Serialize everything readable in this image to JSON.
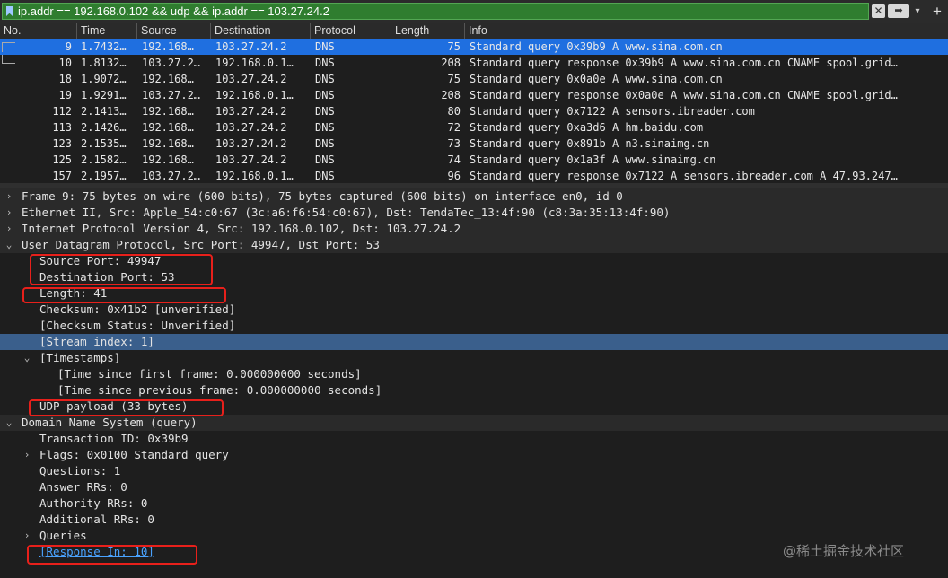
{
  "filter": {
    "value": "ip.addr == 192.168.0.102 && udp && ip.addr == 103.27.24.2",
    "clear_glyph": "✕",
    "apply_glyph": "➡",
    "dropdown_glyph": "▾",
    "add_glyph": "+"
  },
  "packet_list": {
    "columns": [
      "No.",
      "Time",
      "Source",
      "Destination",
      "Protocol",
      "Length",
      "Info"
    ],
    "rows": [
      {
        "no": "9",
        "time": "1.7432…",
        "src": "192.168…",
        "dst": "103.27.24.2",
        "proto": "DNS",
        "len": "75",
        "info": "Standard query 0x39b9 A www.sina.com.cn"
      },
      {
        "no": "10",
        "time": "1.8132…",
        "src": "103.27.2…",
        "dst": "192.168.0.1…",
        "proto": "DNS",
        "len": "208",
        "info": "Standard query response 0x39b9 A www.sina.com.cn CNAME spool.grid…"
      },
      {
        "no": "18",
        "time": "1.9072…",
        "src": "192.168…",
        "dst": "103.27.24.2",
        "proto": "DNS",
        "len": "75",
        "info": "Standard query 0x0a0e A www.sina.com.cn"
      },
      {
        "no": "19",
        "time": "1.9291…",
        "src": "103.27.2…",
        "dst": "192.168.0.1…",
        "proto": "DNS",
        "len": "208",
        "info": "Standard query response 0x0a0e A www.sina.com.cn CNAME spool.grid…"
      },
      {
        "no": "112",
        "time": "2.1413…",
        "src": "192.168…",
        "dst": "103.27.24.2",
        "proto": "DNS",
        "len": "80",
        "info": "Standard query 0x7122 A sensors.ibreader.com"
      },
      {
        "no": "113",
        "time": "2.1426…",
        "src": "192.168…",
        "dst": "103.27.24.2",
        "proto": "DNS",
        "len": "72",
        "info": "Standard query 0xa3d6 A hm.baidu.com"
      },
      {
        "no": "123",
        "time": "2.1535…",
        "src": "192.168…",
        "dst": "103.27.24.2",
        "proto": "DNS",
        "len": "73",
        "info": "Standard query 0x891b A n3.sinaimg.cn"
      },
      {
        "no": "125",
        "time": "2.1582…",
        "src": "192.168…",
        "dst": "103.27.24.2",
        "proto": "DNS",
        "len": "74",
        "info": "Standard query 0x1a3f A www.sinaimg.cn"
      },
      {
        "no": "157",
        "time": "2.1957…",
        "src": "103.27.2…",
        "dst": "192.168.0.1…",
        "proto": "DNS",
        "len": "96",
        "info": "Standard query response 0x7122 A sensors.ibreader.com A 47.93.247…"
      }
    ]
  },
  "details": [
    {
      "text": "Frame 9: 75 bytes on wire (600 bits), 75 bytes captured (600 bits) on interface en0, id 0",
      "arrow": "›"
    },
    {
      "text": "Ethernet II, Src: Apple_54:c0:67 (3c:a6:f6:54:c0:67), Dst: TendaTec_13:4f:90 (c8:3a:35:13:4f:90)",
      "arrow": "›"
    },
    {
      "text": "Internet Protocol Version 4, Src: 192.168.0.102, Dst: 103.27.24.2",
      "arrow": "›"
    },
    {
      "text": "User Datagram Protocol, Src Port: 49947, Dst Port: 53",
      "arrow": "⌄"
    },
    {
      "text": "Source Port: 49947",
      "arrow": ""
    },
    {
      "text": "Destination Port: 53",
      "arrow": ""
    },
    {
      "text": "Length: 41",
      "arrow": ""
    },
    {
      "text": "Checksum: 0x41b2 [unverified]",
      "arrow": ""
    },
    {
      "text": "[Checksum Status: Unverified]",
      "arrow": ""
    },
    {
      "text": "[Stream index: 1]",
      "arrow": ""
    },
    {
      "text": "[Timestamps]",
      "arrow": "⌄"
    },
    {
      "text": "[Time since first frame: 0.000000000 seconds]",
      "arrow": ""
    },
    {
      "text": "[Time since previous frame: 0.000000000 seconds]",
      "arrow": ""
    },
    {
      "text": "UDP payload (33 bytes)",
      "arrow": ""
    },
    {
      "text": "Domain Name System (query)",
      "arrow": "⌄"
    },
    {
      "text": "Transaction ID: 0x39b9",
      "arrow": ""
    },
    {
      "text": "Flags: 0x0100 Standard query",
      "arrow": "›"
    },
    {
      "text": "Questions: 1",
      "arrow": ""
    },
    {
      "text": "Answer RRs: 0",
      "arrow": ""
    },
    {
      "text": "Authority RRs: 0",
      "arrow": ""
    },
    {
      "text": "Additional RRs: 0",
      "arrow": ""
    },
    {
      "text": "Queries",
      "arrow": "›"
    },
    {
      "text": "[Response In: 10]",
      "arrow": ""
    }
  ],
  "watermark": "@稀土掘金技术社区",
  "colors": {
    "filter_valid": "#2f7d2f",
    "selected_row": "#1f6fe0",
    "highlight_row": "#3a5f8c",
    "annotation": "#e8201b",
    "link": "#4aa3ff"
  }
}
